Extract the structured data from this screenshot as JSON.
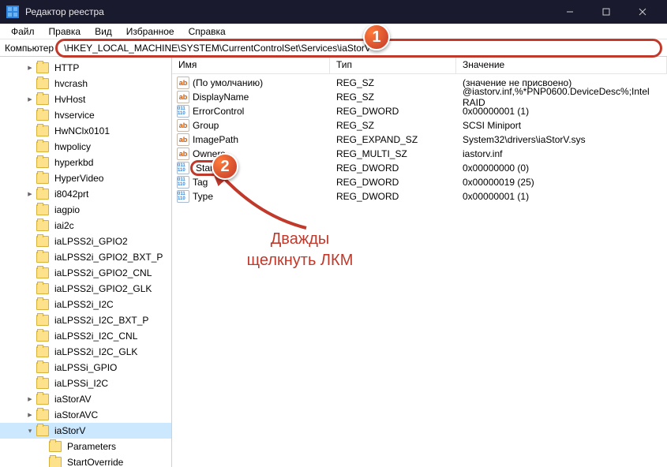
{
  "title": "Редактор реестра",
  "menu": [
    "Файл",
    "Правка",
    "Вид",
    "Избранное",
    "Справка"
  ],
  "address_label": "Компьютер",
  "address_path": "\\HKEY_LOCAL_MACHINE\\SYSTEM\\CurrentControlSet\\Services\\iaStorV",
  "tree": [
    {
      "name": "HTTP",
      "exp": ">"
    },
    {
      "name": "hvcrash",
      "exp": ""
    },
    {
      "name": "HvHost",
      "exp": ">"
    },
    {
      "name": "hvservice",
      "exp": ""
    },
    {
      "name": "HwNClx0101",
      "exp": ""
    },
    {
      "name": "hwpolicy",
      "exp": ""
    },
    {
      "name": "hyperkbd",
      "exp": ""
    },
    {
      "name": "HyperVideo",
      "exp": ""
    },
    {
      "name": "i8042prt",
      "exp": ">"
    },
    {
      "name": "iagpio",
      "exp": ""
    },
    {
      "name": "iai2c",
      "exp": ""
    },
    {
      "name": "iaLPSS2i_GPIO2",
      "exp": ""
    },
    {
      "name": "iaLPSS2i_GPIO2_BXT_P",
      "exp": ""
    },
    {
      "name": "iaLPSS2i_GPIO2_CNL",
      "exp": ""
    },
    {
      "name": "iaLPSS2i_GPIO2_GLK",
      "exp": ""
    },
    {
      "name": "iaLPSS2i_I2C",
      "exp": ""
    },
    {
      "name": "iaLPSS2i_I2C_BXT_P",
      "exp": ""
    },
    {
      "name": "iaLPSS2i_I2C_CNL",
      "exp": ""
    },
    {
      "name": "iaLPSS2i_I2C_GLK",
      "exp": ""
    },
    {
      "name": "iaLPSSi_GPIO",
      "exp": ""
    },
    {
      "name": "iaLPSSi_I2C",
      "exp": ""
    },
    {
      "name": "iaStorAV",
      "exp": ">"
    },
    {
      "name": "iaStorAVC",
      "exp": ">"
    },
    {
      "name": "iaStorV",
      "exp": "v",
      "selected": true
    },
    {
      "name": "Parameters",
      "child": true,
      "exp": ""
    },
    {
      "name": "StartOverride",
      "child": true,
      "exp": ""
    }
  ],
  "columns": {
    "name": "Имя",
    "type": "Тип",
    "value": "Значение"
  },
  "values": [
    {
      "icon": "sz",
      "name": "(По умолчанию)",
      "type": "REG_SZ",
      "value": "(значение не присвоено)"
    },
    {
      "icon": "sz",
      "name": "DisplayName",
      "type": "REG_SZ",
      "value": "@iastorv.inf,%*PNP0600.DeviceDesc%;Intel RAID"
    },
    {
      "icon": "dw",
      "name": "ErrorControl",
      "type": "REG_DWORD",
      "value": "0x00000001 (1)"
    },
    {
      "icon": "sz",
      "name": "Group",
      "type": "REG_SZ",
      "value": "SCSI Miniport"
    },
    {
      "icon": "sz",
      "name": "ImagePath",
      "type": "REG_EXPAND_SZ",
      "value": "System32\\drivers\\iaStorV.sys"
    },
    {
      "icon": "sz",
      "name": "Owners",
      "type": "REG_MULTI_SZ",
      "value": "iastorv.inf"
    },
    {
      "icon": "dw",
      "name": "Start",
      "type": "REG_DWORD",
      "value": "0x00000000 (0)",
      "highlight": true
    },
    {
      "icon": "dw",
      "name": "Tag",
      "type": "REG_DWORD",
      "value": "0x00000019 (25)"
    },
    {
      "icon": "dw",
      "name": "Type",
      "type": "REG_DWORD",
      "value": "0x00000001 (1)"
    }
  ],
  "badges": {
    "1": "1",
    "2": "2"
  },
  "annotation": "Дважды\nщелкнуть ЛКМ"
}
